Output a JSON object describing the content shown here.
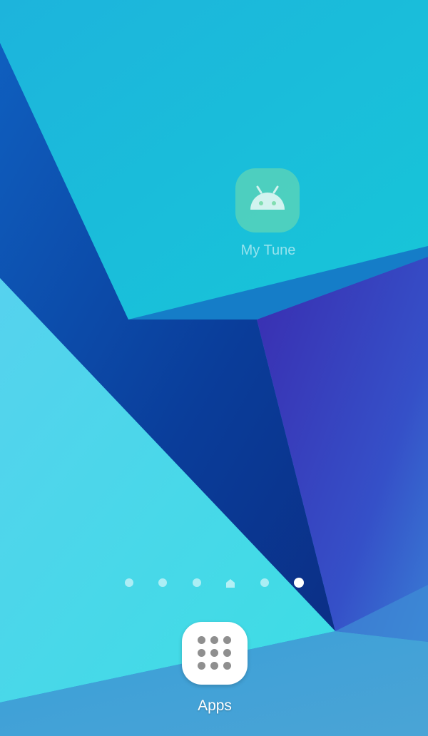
{
  "home_screen": {
    "shortcuts": [
      {
        "label": "My Tune",
        "icon": "android-robot-icon"
      }
    ],
    "page_indicator": {
      "page_count": 6,
      "active_page": 6,
      "home_page": 4
    },
    "dock": {
      "apps_label": "Apps",
      "apps_icon": "app-grid-icon"
    }
  },
  "colors": {
    "wallpaper_top": "#1ac3d9",
    "wallpaper_deep_blue": "#0d47a8",
    "wallpaper_violet": "#3f35b8",
    "wallpaper_light": "#5fd8ee",
    "shortcut_tile": "#78dcaa",
    "apps_tile": "#ffffff",
    "apps_grid_dots": "#8f8f8f"
  }
}
